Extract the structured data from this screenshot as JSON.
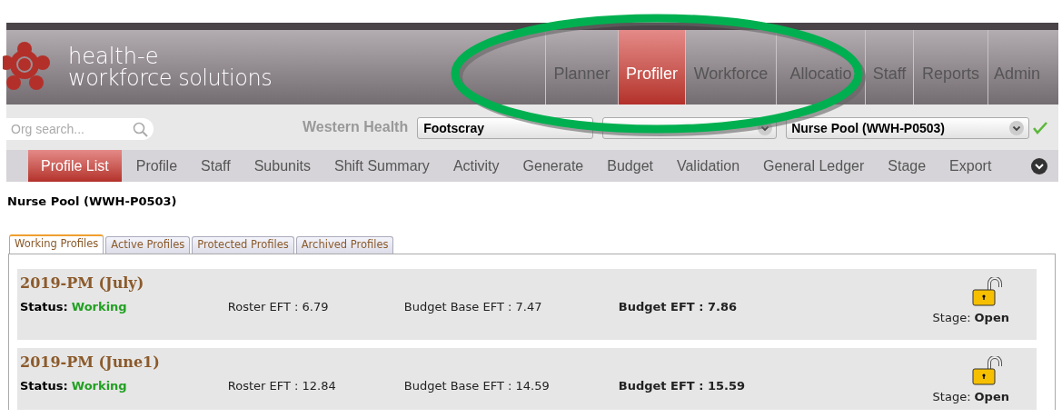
{
  "logo": {
    "line1": "health-e",
    "line2": "workforce solutions"
  },
  "main_nav": [
    {
      "label": "Planner",
      "selected": false
    },
    {
      "label": "Profiler",
      "selected": true
    },
    {
      "label": "Workforce",
      "selected": false
    },
    {
      "label": "Allocatio",
      "selected": false
    },
    {
      "label": "Staff",
      "selected": false
    },
    {
      "label": "Reports",
      "selected": false
    },
    {
      "label": "Admin",
      "selected": false
    }
  ],
  "toolbar": {
    "search": {
      "placeholder": "Org search..."
    },
    "organisation": "Western Health",
    "site_select": "Footscray",
    "unit_select": "Nurse Pool (WWH-P0503)"
  },
  "sub_nav": [
    {
      "label": "Profile List",
      "selected": true
    },
    {
      "label": "Profile",
      "selected": false
    },
    {
      "label": "Staff",
      "selected": false
    },
    {
      "label": "Subunits",
      "selected": false
    },
    {
      "label": "Shift Summary",
      "selected": false
    },
    {
      "label": "Activity",
      "selected": false
    },
    {
      "label": "Generate",
      "selected": false
    },
    {
      "label": "Budget",
      "selected": false
    },
    {
      "label": "Validation",
      "selected": false
    },
    {
      "label": "General Ledger",
      "selected": false
    },
    {
      "label": "Stage",
      "selected": false
    },
    {
      "label": "Export",
      "selected": false
    }
  ],
  "page_title": "Nurse Pool (WWH-P0503)",
  "profile_tabs": [
    {
      "label": "Working Profiles",
      "selected": true
    },
    {
      "label": "Active Profiles",
      "selected": false
    },
    {
      "label": "Protected Profiles",
      "selected": false
    },
    {
      "label": "Archived Profiles",
      "selected": false
    }
  ],
  "profiles": [
    {
      "title": "2019-PM (July)",
      "status_label": "Status:",
      "status": "Working",
      "roster_eft": "Roster EFT : 6.79",
      "budget_base_eft": "Budget Base EFT : 7.47",
      "budget_eft": "Budget EFT : 7.86",
      "stage_label": "Stage:",
      "stage": "Open",
      "locked": false
    },
    {
      "title": "2019-PM (June1)",
      "status_label": "Status:",
      "status": "Working",
      "roster_eft": "Roster EFT : 12.84",
      "budget_base_eft": "Budget Base EFT : 14.59",
      "budget_eft": "Budget EFT : 15.59",
      "stage_label": "Stage:",
      "stage": "Open",
      "locked": false
    }
  ]
}
